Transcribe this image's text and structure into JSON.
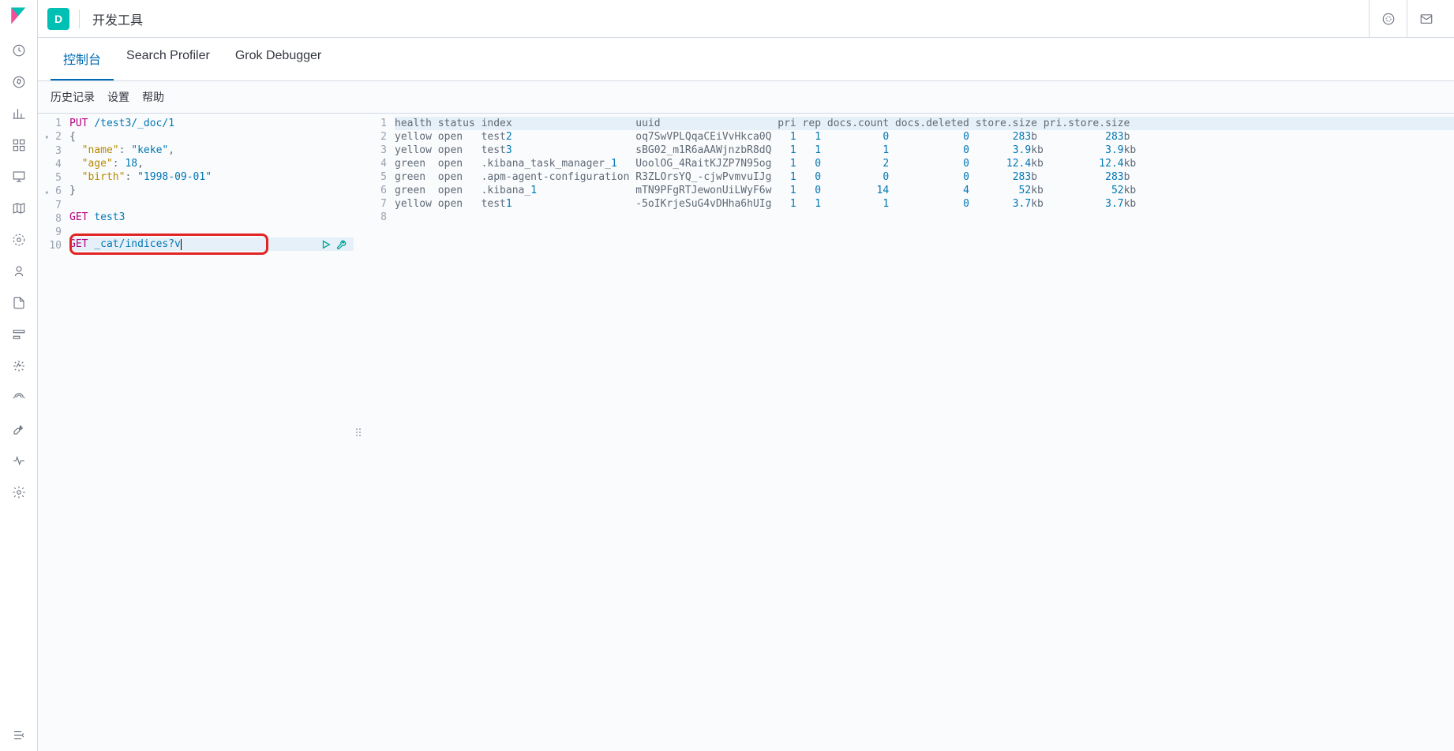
{
  "header": {
    "badge": "D",
    "title": "开发工具"
  },
  "tabs": [
    {
      "label": "控制台",
      "active": true
    },
    {
      "label": "Search Profiler",
      "active": false
    },
    {
      "label": "Grok Debugger",
      "active": false
    }
  ],
  "subtoolbar": [
    {
      "label": "历史记录"
    },
    {
      "label": "设置"
    },
    {
      "label": "帮助"
    }
  ],
  "editor": {
    "lines": [
      {
        "n": 1,
        "method": "PUT",
        "path": "/test3/_doc/1"
      },
      {
        "n": 2,
        "fold": "▾",
        "raw": "{"
      },
      {
        "n": 3,
        "key": "name",
        "val_str": "keke",
        "comma": true,
        "indent": 2
      },
      {
        "n": 4,
        "key": "age",
        "val_num": "18",
        "comma": true,
        "indent": 2
      },
      {
        "n": 5,
        "key": "birth",
        "val_str": "1998-09-01",
        "indent": 2
      },
      {
        "n": 6,
        "fold": "▴",
        "raw": "}"
      },
      {
        "n": 7,
        "blank": true
      },
      {
        "n": 8,
        "method": "GET",
        "path": "test3"
      },
      {
        "n": 9,
        "blank": true
      },
      {
        "n": 10,
        "method": "GET",
        "path": "_cat/indices?v",
        "active": true,
        "cursor": true,
        "actions": true
      }
    ]
  },
  "output": {
    "header": "health status index                    uuid                   pri rep docs.count docs.deleted store.size pri.store.size",
    "rows": [
      {
        "health": "yellow",
        "status": "open",
        "index": "test",
        "idx_num": "2",
        "uuid": "oq7SwVPLQqaCEiVvHkca0Q",
        "pri": "1",
        "rep": "1",
        "dc": "0",
        "dd": "0",
        "ss": "283",
        "ssu": "b",
        "pss": "283",
        "pssu": "b"
      },
      {
        "health": "yellow",
        "status": "open",
        "index": "test",
        "idx_num": "3",
        "uuid": "sBG02_m1R6aAAWjnzbR8dQ",
        "pri": "1",
        "rep": "1",
        "dc": "1",
        "dd": "0",
        "ss": "3.9",
        "ssu": "kb",
        "pss": "3.9",
        "pssu": "kb"
      },
      {
        "health": "green",
        "status": "open",
        "index": ".kibana_task_manager_",
        "idx_num": "1",
        "uuid": "UoolOG_4RaitKJZP7N95og",
        "pri": "1",
        "rep": "0",
        "dc": "2",
        "dd": "0",
        "ss": "12.4",
        "ssu": "kb",
        "pss": "12.4",
        "pssu": "kb"
      },
      {
        "health": "green",
        "status": "open",
        "index": ".apm-agent-configuration",
        "idx_num": "",
        "uuid": "R3ZLOrsYQ_-cjwPvmvuIJg",
        "pri": "1",
        "rep": "0",
        "dc": "0",
        "dd": "0",
        "ss": "283",
        "ssu": "b",
        "pss": "283",
        "pssu": "b"
      },
      {
        "health": "green",
        "status": "open",
        "index": ".kibana_",
        "idx_num": "1",
        "uuid": "mTN9PFgRTJewonUiLWyF6w",
        "pri": "1",
        "rep": "0",
        "dc": "14",
        "dd": "4",
        "ss": "52",
        "ssu": "kb",
        "pss": "52",
        "pssu": "kb"
      },
      {
        "health": "yellow",
        "status": "open",
        "index": "test",
        "idx_num": "1",
        "uuid": "-5oIKrjeSuG4vDHha6hUIg",
        "pri": "1",
        "rep": "1",
        "dc": "1",
        "dd": "0",
        "ss": "3.7",
        "ssu": "kb",
        "pss": "3.7",
        "pssu": "kb"
      }
    ],
    "trailing_lines": [
      8
    ]
  }
}
